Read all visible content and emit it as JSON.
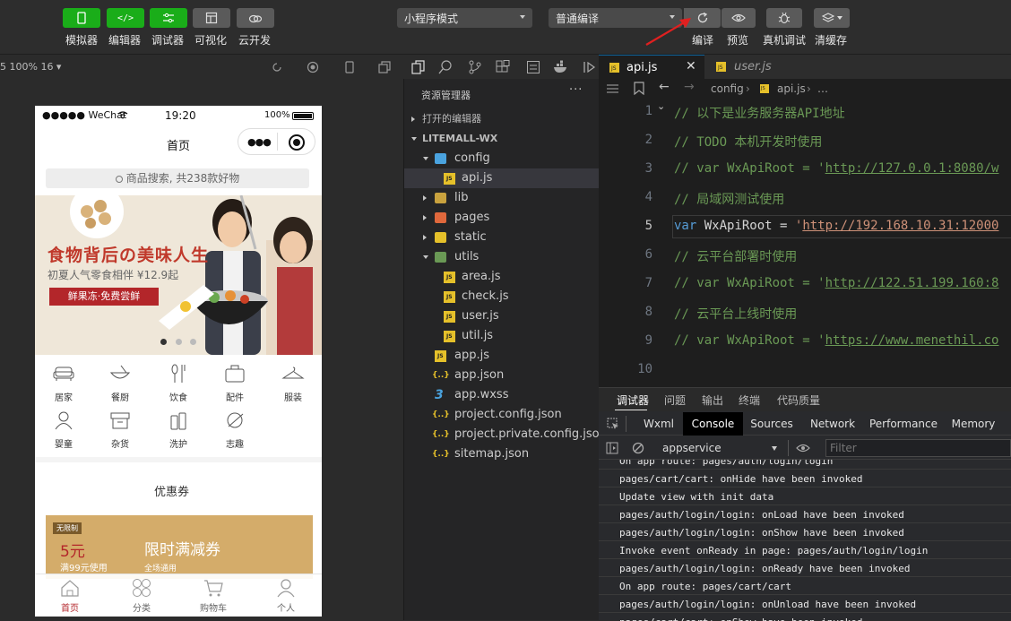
{
  "toolbar": {
    "left_buttons": [
      {
        "label": "模拟器",
        "icon": "phone-icon"
      },
      {
        "label": "编辑器",
        "icon": "code-icon"
      },
      {
        "label": "调试器",
        "icon": "debug-icon"
      },
      {
        "label": "可视化",
        "icon": "layout-icon"
      },
      {
        "label": "云开发",
        "icon": "cloud-icon"
      }
    ],
    "mode_select": "小程序模式",
    "compile_select": "普通编译",
    "right_buttons": [
      {
        "label": "编译",
        "icon": "refresh-icon"
      },
      {
        "label": "预览",
        "icon": "eye-icon"
      },
      {
        "label": "真机调试",
        "icon": "bug-icon"
      },
      {
        "label": "清缓存",
        "icon": "layers-icon"
      }
    ]
  },
  "simulator": {
    "zoom_label": "5 100% 16 ▾",
    "status": {
      "carrier": "●●●●● WeChat",
      "time": "19:20",
      "battery": "100%"
    },
    "page_title": "首页",
    "search_placeholder": "商品搜索, 共238款好物",
    "banner": {
      "headline": "食物背后の美味人生",
      "subline": "初夏人气零食相伴 ¥12.9起",
      "button": "鲜果冻·免费尝鲜"
    },
    "categories": [
      "居家",
      "餐厨",
      "饮食",
      "配件",
      "服装",
      "婴童",
      "杂货",
      "洗护",
      "志趣"
    ],
    "coupon": {
      "section_title": "优惠券",
      "tag": "无限制",
      "amount": "5元",
      "condition": "满99元使用",
      "title": "限时满减券",
      "scope": "全场通用"
    },
    "tabbar": [
      "首页",
      "分类",
      "购物车",
      "个人"
    ]
  },
  "explorer": {
    "title": "资源管理器",
    "open_editors": "打开的编辑器",
    "project": "LITEMALL-WX",
    "items": [
      {
        "name": "config",
        "type": "folder-open",
        "depth": 1
      },
      {
        "name": "api.js",
        "type": "js",
        "depth": 2,
        "selected": true
      },
      {
        "name": "lib",
        "type": "folder",
        "depth": 1
      },
      {
        "name": "pages",
        "type": "folder",
        "depth": 1
      },
      {
        "name": "static",
        "type": "folder",
        "depth": 1
      },
      {
        "name": "utils",
        "type": "folder-open",
        "depth": 1
      },
      {
        "name": "area.js",
        "type": "js",
        "depth": 2
      },
      {
        "name": "check.js",
        "type": "js",
        "depth": 2
      },
      {
        "name": "user.js",
        "type": "js",
        "depth": 2
      },
      {
        "name": "util.js",
        "type": "js",
        "depth": 2
      },
      {
        "name": "app.js",
        "type": "js",
        "depth": 1
      },
      {
        "name": "app.json",
        "type": "json",
        "depth": 1
      },
      {
        "name": "app.wxss",
        "type": "wxss",
        "depth": 1
      },
      {
        "name": "project.config.json",
        "type": "json",
        "depth": 1
      },
      {
        "name": "project.private.config.json",
        "type": "json",
        "depth": 1
      },
      {
        "name": "sitemap.json",
        "type": "json",
        "depth": 1
      }
    ]
  },
  "editor": {
    "tabs": [
      {
        "label": "api.js",
        "active": true
      },
      {
        "label": "user.js",
        "active": false
      }
    ],
    "breadcrumb": [
      "config",
      "api.js",
      "…"
    ],
    "current_line": 5,
    "lines": [
      {
        "n": "1",
        "parts": [
          {
            "t": "// 以下是业务服务器API地址",
            "c": "cmt"
          }
        ]
      },
      {
        "n": "2",
        "parts": [
          {
            "t": "// TODO 本机开发时使用",
            "c": "cmt"
          }
        ]
      },
      {
        "n": "3",
        "parts": [
          {
            "t": "// var WxApiRoot = '",
            "c": "cmt"
          },
          {
            "t": "http://127.0.0.1:8080/w",
            "c": "url"
          }
        ]
      },
      {
        "n": "4",
        "parts": [
          {
            "t": "// 局域网测试使用",
            "c": "cmt"
          }
        ]
      },
      {
        "n": "5",
        "parts": [
          {
            "t": "var",
            "c": "kw"
          },
          {
            "t": " WxApiRoot = ",
            "c": "txt"
          },
          {
            "t": "'",
            "c": "str"
          },
          {
            "t": "http://192.168.10.31:12000",
            "c": "url-r"
          }
        ]
      },
      {
        "n": "6",
        "parts": [
          {
            "t": "// 云平台部署时使用",
            "c": "cmt"
          }
        ]
      },
      {
        "n": "7",
        "parts": [
          {
            "t": "// var WxApiRoot = '",
            "c": "cmt"
          },
          {
            "t": "http://122.51.199.160:8",
            "c": "url"
          }
        ]
      },
      {
        "n": "8",
        "parts": [
          {
            "t": "// 云平台上线时使用",
            "c": "cmt"
          }
        ]
      },
      {
        "n": "9",
        "parts": [
          {
            "t": "// var WxApiRoot = '",
            "c": "cmt"
          },
          {
            "t": "https://www.menethil.co",
            "c": "url"
          }
        ]
      },
      {
        "n": "10",
        "parts": []
      }
    ]
  },
  "debug": {
    "panel_tabs": [
      "调试器",
      "问题",
      "输出",
      "终端",
      "代码质量"
    ],
    "devtools_tabs": [
      "Wxml",
      "Console",
      "Sources",
      "Network",
      "Performance",
      "Memory"
    ],
    "active_devtools_tab": "Console",
    "context": "appservice",
    "filter_placeholder": "Filter",
    "console_lines": [
      "On app route: pages/auth/login/login",
      "pages/cart/cart: onHide have been invoked",
      "Update view with init data",
      "pages/auth/login/login: onLoad have been invoked",
      "pages/auth/login/login: onShow have been invoked",
      "Invoke event onReady in page: pages/auth/login/login",
      "pages/auth/login/login: onReady have been invoked",
      "On app route: pages/cart/cart",
      "pages/auth/login/login: onUnload have been invoked",
      "pages/cart/cart: onShow have been invoked"
    ]
  }
}
